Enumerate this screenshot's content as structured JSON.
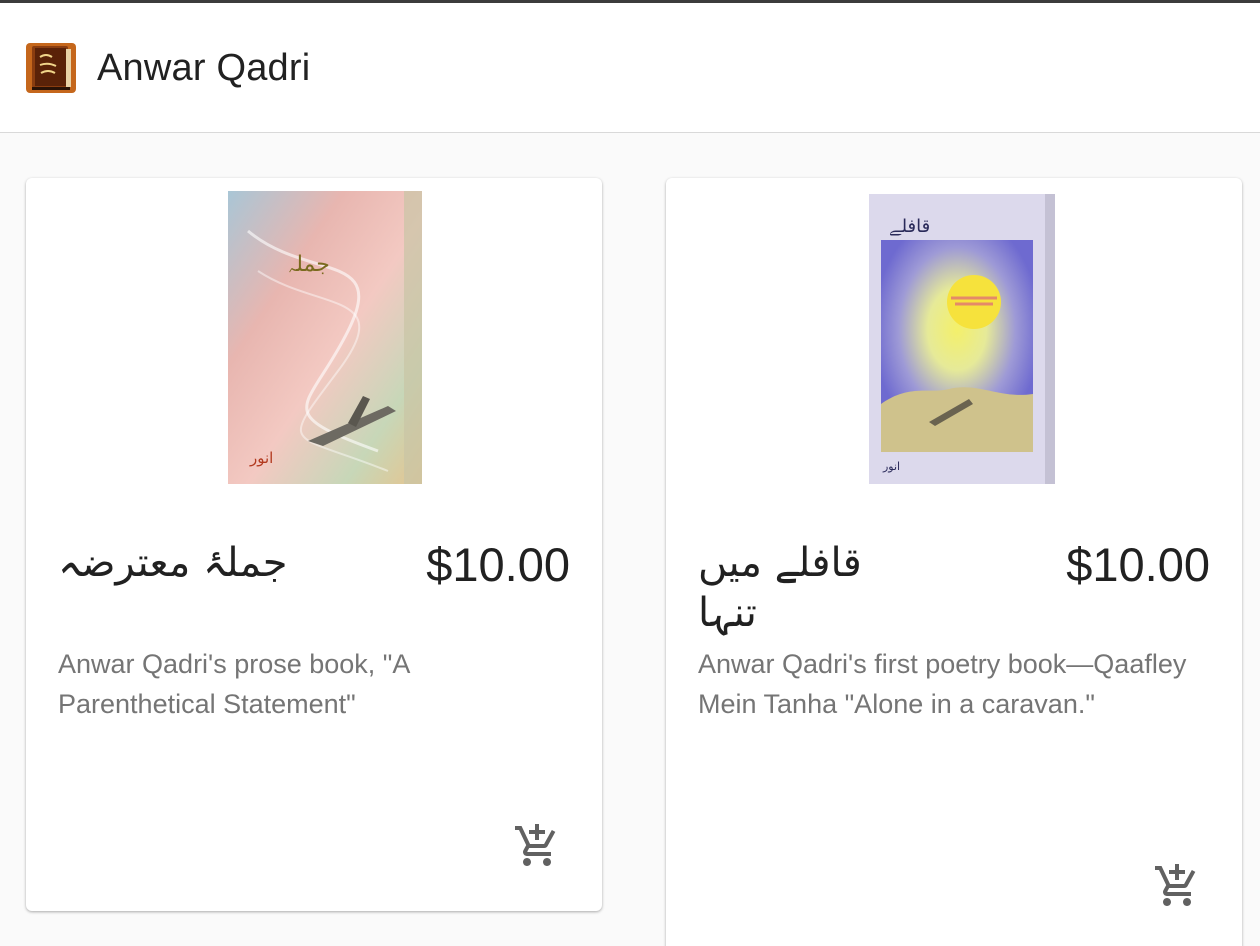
{
  "app": {
    "title": "Anwar Qadri",
    "logo_icon": "urdu-library-book-icon"
  },
  "products": [
    {
      "title_urdu": "جملۂ معترضہ",
      "price": "$10.00",
      "description": "Anwar Qadri's prose book, \"A Parenthetical Statement\"",
      "cover_icon": "book-cover-airplane",
      "cart_icon": "add-shopping-cart-icon"
    },
    {
      "title_urdu": "قافلے میں تنہا",
      "price": "$10.00",
      "description": "Anwar Qadri's first poetry book—Qaafley Mein Tanha \"Alone in a caravan.\"",
      "cover_icon": "book-cover-sun",
      "cart_icon": "add-shopping-cart-icon"
    }
  ],
  "colors": {
    "text_primary": "#212121",
    "text_secondary": "#757575",
    "background": "#fafafa"
  }
}
